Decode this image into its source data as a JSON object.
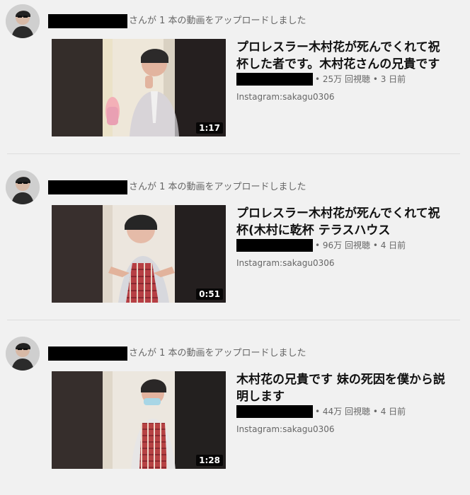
{
  "feed": {
    "items": [
      {
        "upload_text": "さんが 1 本の動画をアップロードしました",
        "title": "プロレスラー木村花が死んでくれて祝杯した者です。木村花さんの兄貴です",
        "views": "25万 回視聴",
        "age": "3 日前",
        "description": "Instagram:sakagu0306",
        "duration": "1:17"
      },
      {
        "upload_text": "さんが 1 本の動画をアップロードしました",
        "title": "プロレスラー木村花が死んでくれて祝杯(木村に乾杯 テラスハウス",
        "views": "96万 回視聴",
        "age": "4 日前",
        "description": "Instagram:sakagu0306",
        "duration": "0:51"
      },
      {
        "upload_text": "さんが 1 本の動画をアップロードしました",
        "title": "木村花の兄貴です 妹の死因を僕から説明します",
        "views": "44万 回視聴",
        "age": "4 日前",
        "description": "Instagram:sakagu0306",
        "duration": "1:28"
      }
    ]
  }
}
